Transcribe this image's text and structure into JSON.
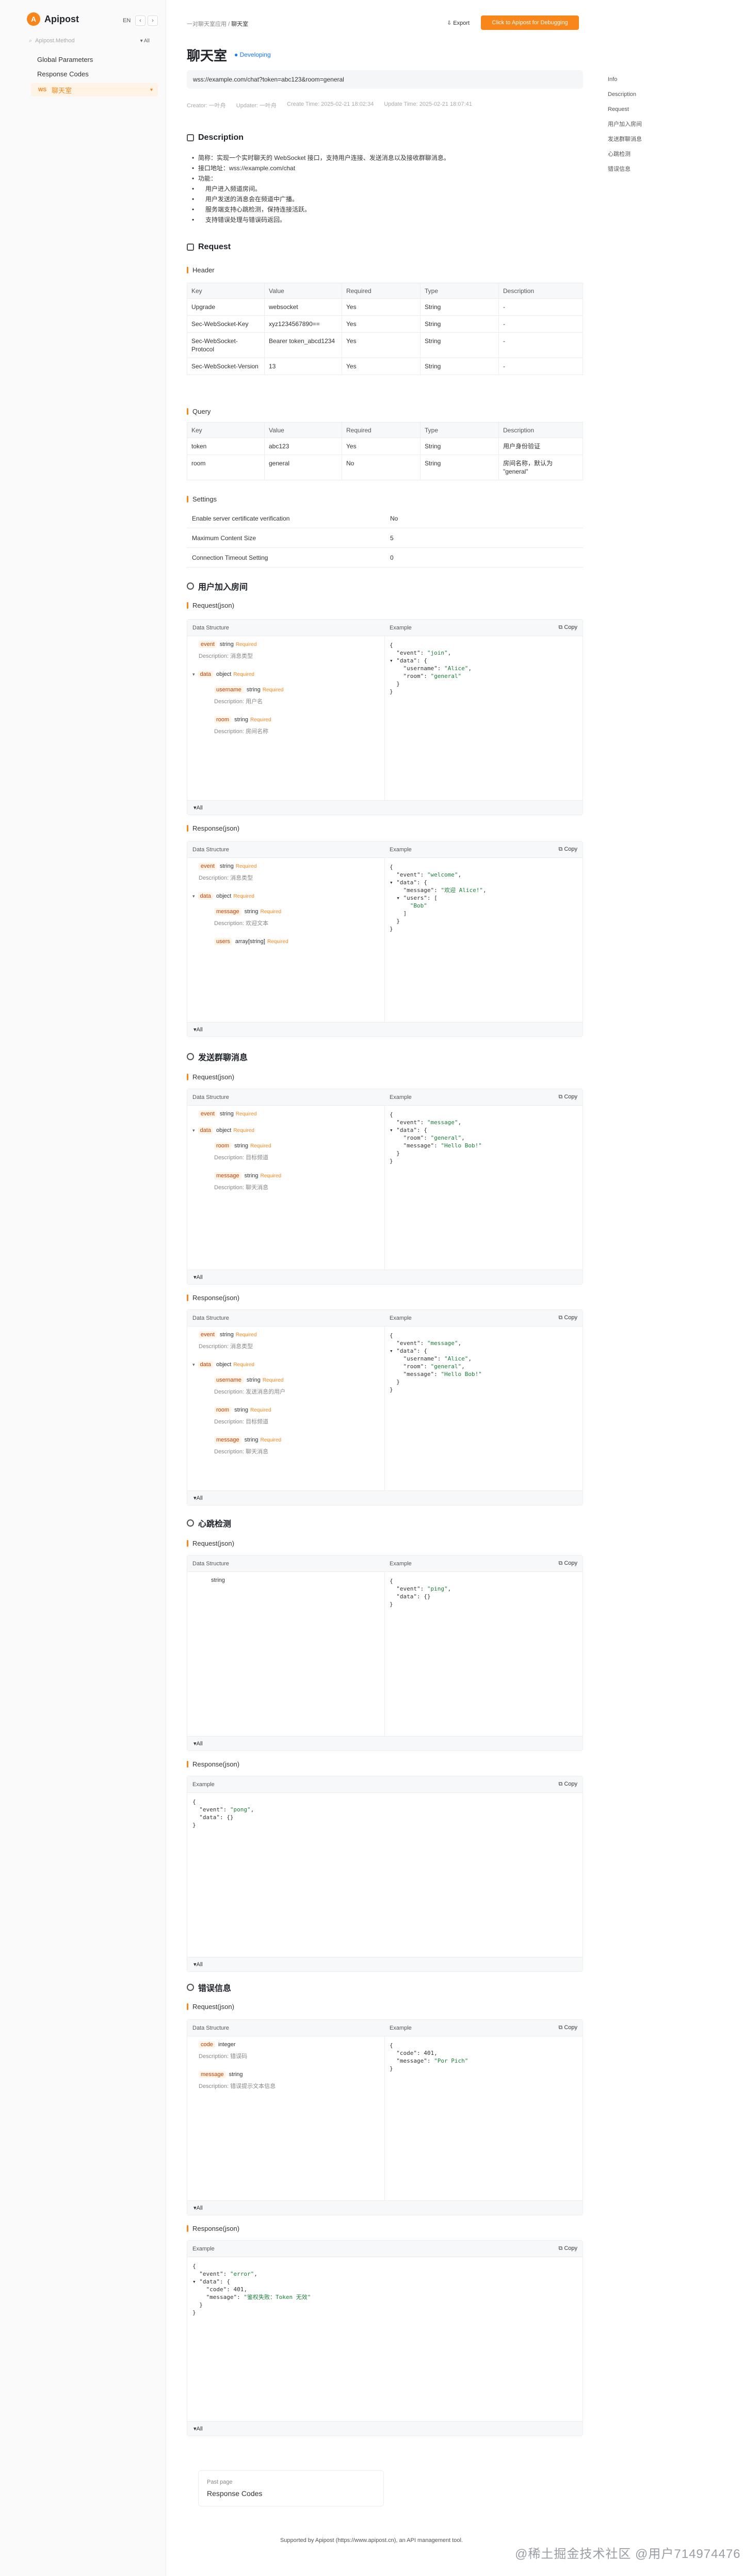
{
  "sidebar": {
    "logo": "Apipost",
    "lang": "EN",
    "search_placeholder": "Apipost.Method",
    "search_filter": "All",
    "items": [
      "Global Parameters",
      "Response Codes"
    ],
    "active_tag": "WS",
    "active_label": "聊天室"
  },
  "header": {
    "crumb_parent": "一对聊天室应用",
    "crumb_current": "聊天室",
    "export": "Export",
    "debug_button": "Click to Apipost for Debugging"
  },
  "api": {
    "title": "聊天室",
    "status": "Developing",
    "url": "wss://example.com/chat?token=abc123&room=general",
    "creator": "Creator: 一叶舟",
    "updater": "Updater: 一叶舟",
    "create_time": "Create Time: 2025-02-21 18:02:34",
    "update_time": "Update Time: 2025-02-21 18:07:41"
  },
  "description": {
    "heading": "Description",
    "l1": "简称：实现一个实时聊天的 WebSocket 接口，支持用户连接、发送消息以及接收群聊消息。",
    "l2": "接口地址：wss://example.com/chat",
    "l3": "功能：",
    "f1": "用户进入频道房间。",
    "f2": "用户发送的消息会在频道中广播。",
    "f3": "服务端支持心跳检测，保持连接活跃。",
    "f4": "支持错误处理与错误码返回。"
  },
  "request": {
    "heading": "Request",
    "header_label": "Header",
    "query_label": "Query",
    "settings_label": "Settings",
    "columns": [
      "Key",
      "Value",
      "Required",
      "Type",
      "Description"
    ],
    "headers": [
      [
        "Upgrade",
        "websocket",
        "Yes",
        "String",
        "-"
      ],
      [
        "Sec-WebSocket-Key",
        "xyz1234567890==",
        "Yes",
        "String",
        "-"
      ],
      [
        "Sec-WebSocket-Protocol",
        "Bearer token_abcd1234",
        "Yes",
        "String",
        "-"
      ],
      [
        "Sec-WebSocket-Version",
        "13",
        "Yes",
        "String",
        "-"
      ]
    ],
    "query": [
      [
        "token",
        "abc123",
        "Yes",
        "String",
        "用户身份验证"
      ],
      [
        "room",
        "general",
        "No",
        "String",
        "房间名称，默认为 \"general\""
      ]
    ],
    "settings": [
      [
        "Enable server certificate verification",
        "No"
      ],
      [
        "Maximum Content Size",
        "5"
      ],
      [
        "Connection Timeout Setting",
        "0"
      ]
    ]
  },
  "labels": {
    "request_json": "Request(json)",
    "response_json": "Response(json)",
    "data_structure": "Data Structure",
    "example": "Example",
    "copy": "Copy",
    "all": "All",
    "required": "Required",
    "description": "Description:"
  },
  "events": {
    "join": "用户加入房间",
    "message": "发送群聊消息",
    "heartbeat": "心跳检测",
    "error": "错误信息"
  },
  "fields": {
    "event": "event",
    "data": "data",
    "username": "username",
    "room": "room",
    "message": "message",
    "users": "users",
    "code": "code",
    "t_string": "string",
    "t_object": "object",
    "t_integer": "integer",
    "t_array": "array[string]",
    "d_event": "消息类型",
    "d_username": "用户名",
    "d_room": "房间名称",
    "d_message": "欢迎文本",
    "d_code": "错误码",
    "d_errmsg": "错误提示文本信息",
    "d_room2": "目标频道",
    "d_msg2": "聊天消息",
    "d_user2": "发送消息的用户"
  },
  "footer": {
    "prev_label": "Past page",
    "prev_title": "Response Codes",
    "supported": "Supported by Apipost (https://www.apipost.cn), an API management tool.",
    "watermark": "@稀土掘金技术社区 @用户714974476"
  },
  "right_nav": [
    "Info",
    "Description",
    "Request",
    "用户加入房间",
    "发送群聊消息",
    "心跳检测",
    "错误信息"
  ]
}
